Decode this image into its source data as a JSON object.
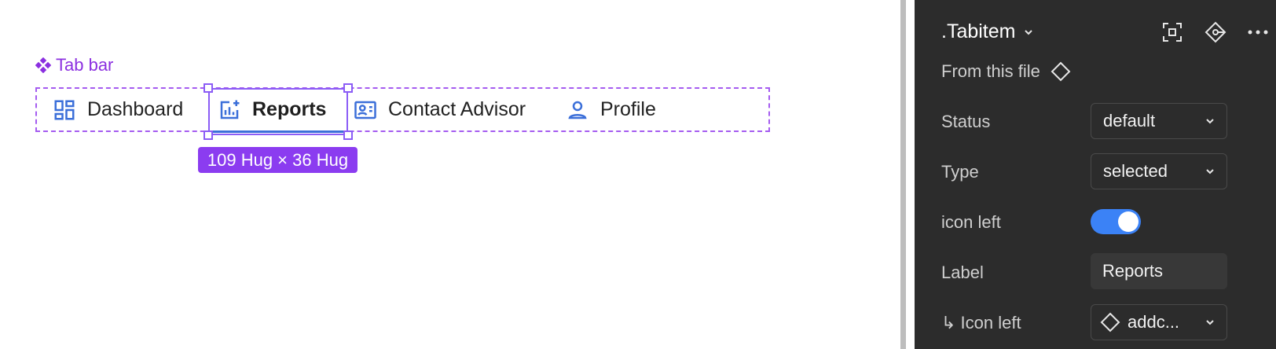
{
  "canvas": {
    "frame_label": "Tab bar",
    "tabs": [
      {
        "label": "Dashboard",
        "icon": "dashboard-icon"
      },
      {
        "label": "Reports",
        "icon": "add-chart-icon",
        "selected": true
      },
      {
        "label": "Contact Advisor",
        "icon": "contact-card-icon"
      },
      {
        "label": "Profile",
        "icon": "person-icon"
      }
    ],
    "size_badge": "109 Hug × 36 Hug",
    "accent_color": "#8b5cf6",
    "tab_icon_color": "#3b6fd9"
  },
  "panel": {
    "title": ".Tabitem",
    "source": "From this file",
    "properties": [
      {
        "label": "Status",
        "value": "default",
        "kind": "select"
      },
      {
        "label": "Type",
        "value": "selected",
        "kind": "select"
      },
      {
        "label": "icon left",
        "value": "on",
        "kind": "toggle"
      },
      {
        "label": "Label",
        "value": "Reports",
        "kind": "text"
      },
      {
        "label": "↳ Icon left",
        "value": "addc...",
        "kind": "instance-select"
      }
    ],
    "toggle_color": "#3b82f6",
    "background": "#2c2c2c"
  }
}
